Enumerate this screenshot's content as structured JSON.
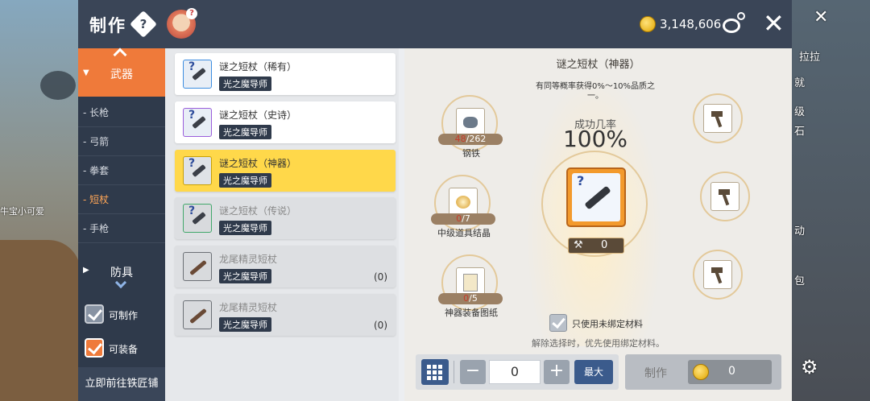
{
  "background": {
    "left_name": "牛宝小可爱",
    "right_texts": [
      "拉拉",
      "就",
      "级",
      "石",
      "动",
      "包"
    ]
  },
  "header": {
    "title": "制作",
    "help_glyph": "?",
    "meso": "3,148,606",
    "icons": [
      "help-icon",
      "avatar-icon",
      "coin-icon",
      "inventory-icon",
      "close-icon"
    ]
  },
  "sidebar": {
    "weapon_label": "武器",
    "subcategories": [
      {
        "label": "- 长枪",
        "active": false
      },
      {
        "label": "- 弓箭",
        "active": false
      },
      {
        "label": "- 拳套",
        "active": false
      },
      {
        "label": "- 短杖",
        "active": true
      },
      {
        "label": "- 手枪",
        "active": false
      }
    ],
    "armor_label": "防具",
    "filters": {
      "craftable_label": "可制作",
      "equippable_label": "可装备"
    },
    "goto_smith_label": "立即前往铁匠铺"
  },
  "items": [
    {
      "name": "谜之短杖（稀有）",
      "tag": "光之魔导师",
      "count": ""
    },
    {
      "name": "谜之短杖（史诗）",
      "tag": "光之魔导师",
      "count": ""
    },
    {
      "name": "谜之短杖（神器）",
      "tag": "光之魔导师",
      "count": ""
    },
    {
      "name": "谜之短杖（传说）",
      "tag": "光之魔导师",
      "count": ""
    },
    {
      "name": "龙尾精灵短杖",
      "tag": "光之魔导师",
      "count": "(0)"
    },
    {
      "name": "龙尾精灵短杖",
      "tag": "光之魔导师",
      "count": "(0)"
    }
  ],
  "detail": {
    "title": "谜之短杖（神器）",
    "rate_note": "有同等概率获得0%～10%品质之一。",
    "rate_label": "成功几率",
    "rate_value": "100%",
    "hammer_value": "0",
    "materials": [
      {
        "have": "48",
        "need": "262",
        "name": "钢铁"
      },
      {
        "have": "0",
        "need": "7",
        "name": "中级道具结晶"
      },
      {
        "have": "0",
        "need": "5",
        "name": "神器装备图纸"
      }
    ],
    "unbound_label": "只使用未绑定材料",
    "unbound_hint": "解除选择时，优先使用绑定材料。",
    "quantity": "0",
    "minus_label": "−",
    "plus_label": "+",
    "max_label": "最大",
    "craft_label": "制作",
    "craft_cost": "0"
  },
  "colors": {
    "header_bg": "#3a4557",
    "accent_orange": "#ef7a3a",
    "selected_item": "#ffd84a",
    "button_blue": "#3b5b8c"
  }
}
